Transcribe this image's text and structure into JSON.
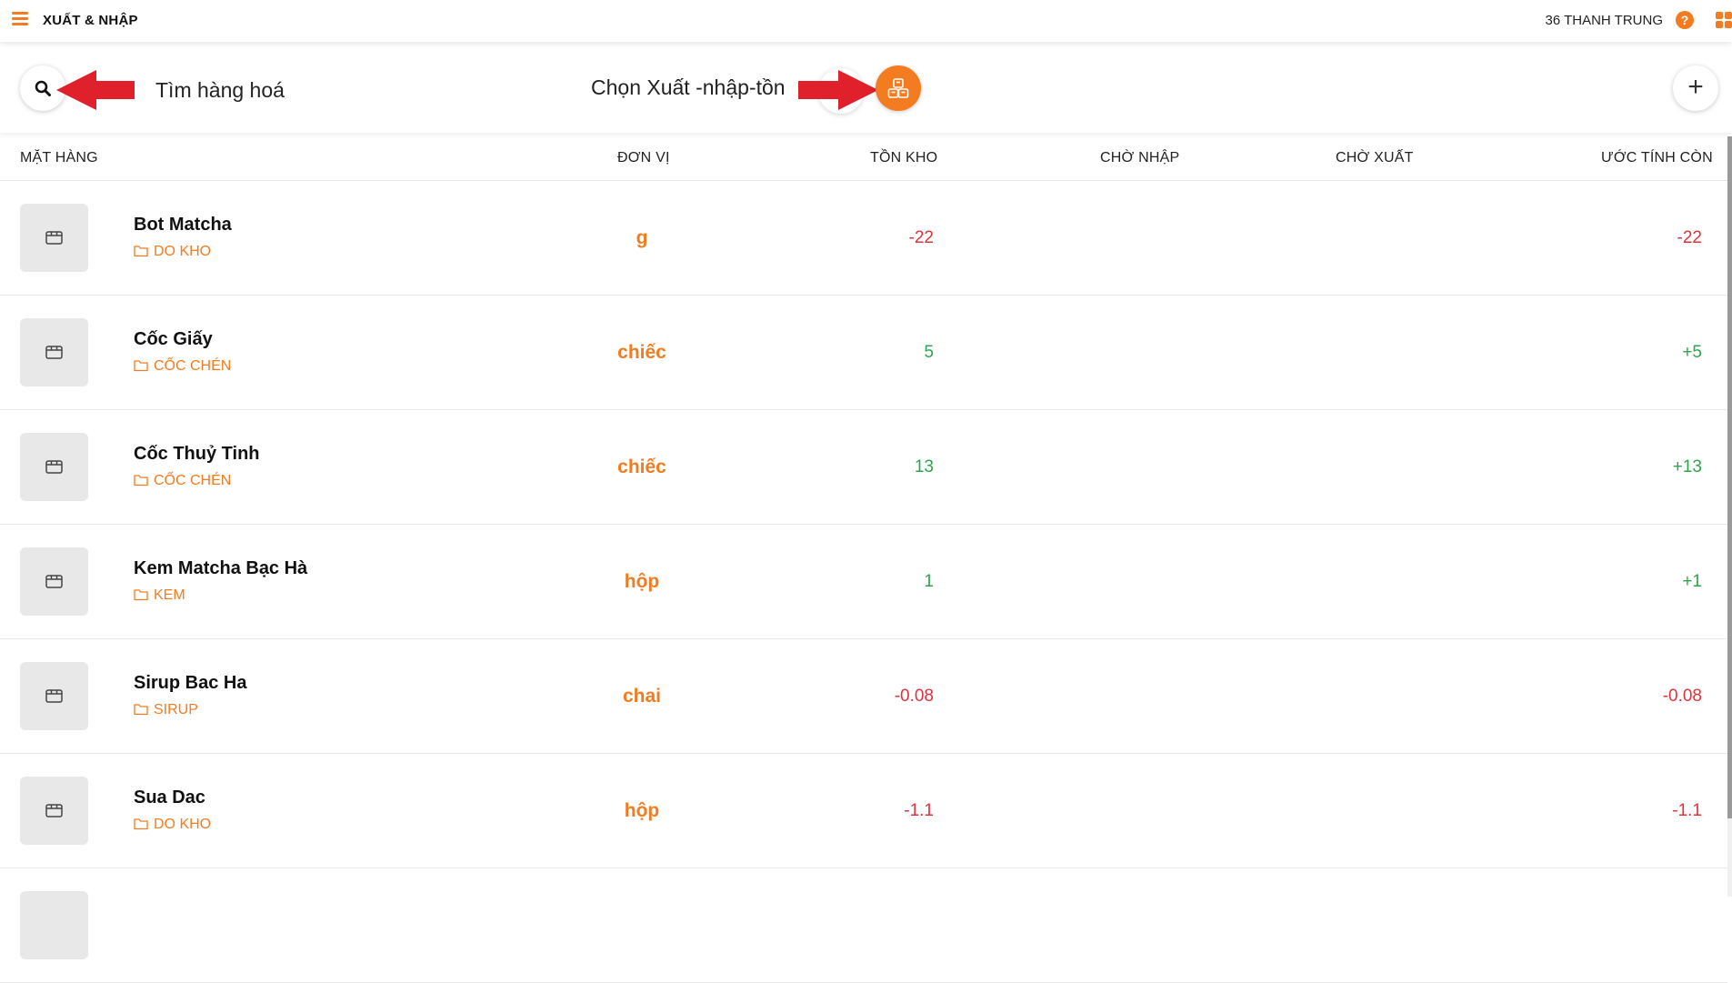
{
  "header": {
    "title": "XUẤT & NHẬP",
    "store_name": "36 THANH TRUNG",
    "help_label": "?"
  },
  "toolbar": {
    "search_label": "Tìm hàng hoá",
    "select_label": "Chọn Xuất -nhập-tồn",
    "add_label": "+"
  },
  "columns": [
    "MẶT HÀNG",
    "ĐƠN VỊ",
    "TỒN KHO",
    "CHỜ NHẬP",
    "CHỜ XUẤT",
    "ƯỚC TÍNH CÒN"
  ],
  "items": [
    {
      "name": "Bot Matcha",
      "category": "DO KHO",
      "unit": "g",
      "stock": "-22",
      "pending_in": "",
      "pending_out": "",
      "estimate": "-22"
    },
    {
      "name": "Cốc Giấy",
      "category": "CỐC CHÉN",
      "unit": "chiếc",
      "stock": "5",
      "pending_in": "",
      "pending_out": "",
      "estimate": "+5"
    },
    {
      "name": "Cốc Thuỷ Tinh",
      "category": "CỐC CHÉN",
      "unit": "chiếc",
      "stock": "13",
      "pending_in": "",
      "pending_out": "",
      "estimate": "+13"
    },
    {
      "name": "Kem Matcha Bạc Hà",
      "category": "KEM",
      "unit": "hộp",
      "stock": "1",
      "pending_in": "",
      "pending_out": "",
      "estimate": "+1"
    },
    {
      "name": "Sirup Bac Ha",
      "category": "SIRUP",
      "unit": "chai",
      "stock": "-0.08",
      "pending_in": "",
      "pending_out": "",
      "estimate": "-0.08"
    },
    {
      "name": "Sua Dac",
      "category": "DO KHO",
      "unit": "hộp",
      "stock": "-1.1",
      "pending_in": "",
      "pending_out": "",
      "estimate": "-1.1"
    }
  ],
  "colors": {
    "accent": "#f47c20",
    "negative": "#e0323f",
    "positive": "#2ea44f",
    "annotation_arrow": "#e0202a"
  },
  "icons": {
    "menu": "hamburger-menu-icon",
    "help": "help-circle-icon",
    "apps": "apps-grid-icon",
    "search": "search-icon",
    "import_export": "boxes-icon",
    "add": "plus-icon",
    "product": "box-icon",
    "category": "folder-icon"
  }
}
